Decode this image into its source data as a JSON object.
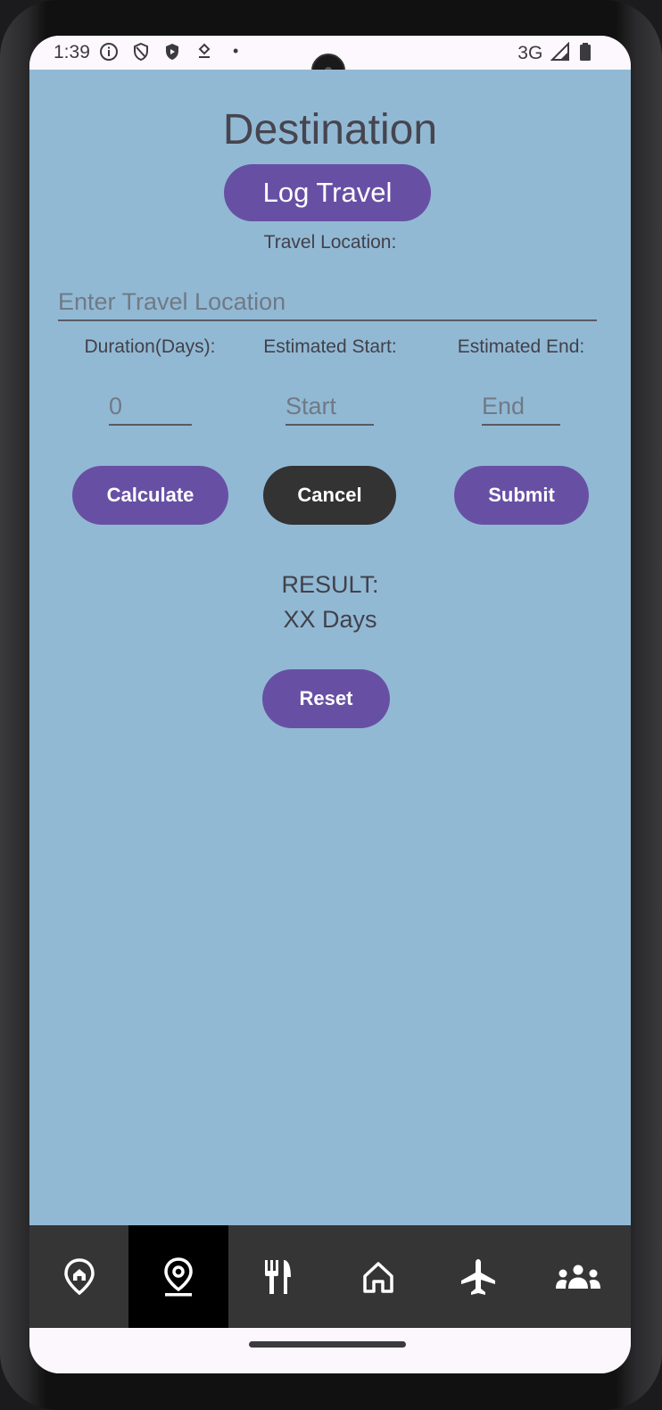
{
  "status_bar": {
    "time": "1:39",
    "network": "3G",
    "dot": "•"
  },
  "page": {
    "title": "Destination",
    "log_button": "Log Travel",
    "location_label": "Travel Location:",
    "location_placeholder": "Enter Travel Location",
    "duration_label": "Duration(Days):",
    "start_label": "Estimated Start:",
    "end_label": "Estimated End:",
    "duration_placeholder": "0",
    "start_placeholder": "Start",
    "end_placeholder": "End",
    "calculate_button": "Calculate",
    "cancel_button": "Cancel",
    "submit_button": "Submit",
    "result_label": "RESULT:",
    "result_value": "XX Days",
    "reset_button": "Reset"
  },
  "nav": {
    "items": [
      {
        "icon": "home-pin-icon",
        "active": false
      },
      {
        "icon": "location-pin-icon",
        "active": true
      },
      {
        "icon": "restaurant-icon",
        "active": false
      },
      {
        "icon": "house-icon",
        "active": false
      },
      {
        "icon": "airplane-icon",
        "active": false
      },
      {
        "icon": "group-icon",
        "active": false
      }
    ]
  },
  "colors": {
    "background": "#92b9d4",
    "accent": "#6750a4",
    "cancel": "#333333",
    "navbar": "#353535",
    "nav_active": "#000000"
  }
}
